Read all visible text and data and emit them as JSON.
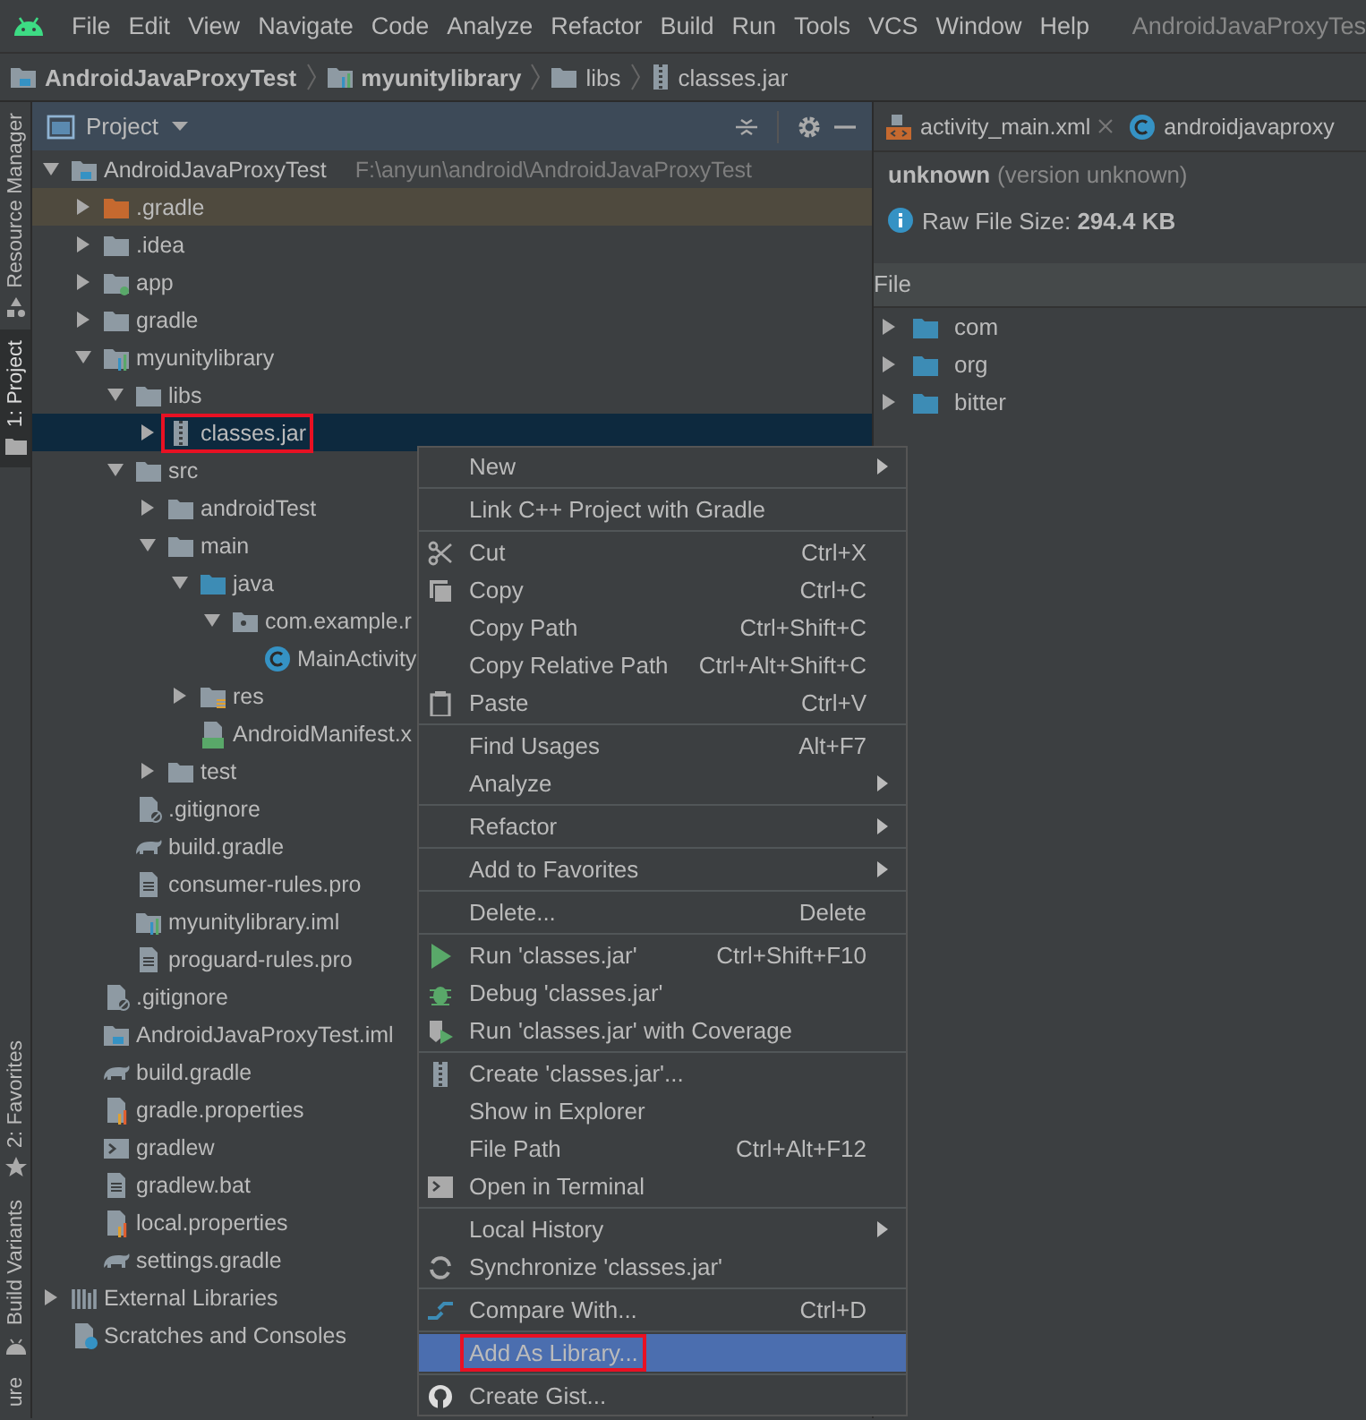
{
  "menu_bar": {
    "items": [
      "File",
      "Edit",
      "View",
      "Navigate",
      "Code",
      "Analyze",
      "Refactor",
      "Build",
      "Run",
      "Tools",
      "VCS",
      "Window",
      "Help"
    ],
    "title": "AndroidJavaProxyTes"
  },
  "breadcrumbs": [
    {
      "label": "AndroidJavaProxyTest",
      "kind": "project"
    },
    {
      "label": "myunitylibrary",
      "kind": "module"
    },
    {
      "label": "libs",
      "kind": "folder"
    },
    {
      "label": "classes.jar",
      "kind": "jar"
    }
  ],
  "tool_strip": {
    "top": [
      {
        "label": "Resource Manager",
        "kind": "resources",
        "selected": false
      },
      {
        "label": "1: Project",
        "kind": "project",
        "selected": true
      }
    ],
    "bottom": [
      {
        "label": "2: Favorites",
        "kind": "favorites",
        "selected": false
      },
      {
        "label": "Build Variants",
        "kind": "variants",
        "selected": false
      },
      {
        "label": "ure",
        "kind": "none",
        "selected": false
      }
    ]
  },
  "project_panel": {
    "title": "Project"
  },
  "tree": [
    {
      "label": "AndroidJavaProxyTest",
      "path": "F:\\anyun\\android\\AndroidJavaProxyTest",
      "kind": "project",
      "expanded": true,
      "selected": false,
      "highlighted": false,
      "children": [
        {
          "label": ".gradle",
          "kind": "excluded",
          "expanded": false,
          "selected": false,
          "highlighted": false
        },
        {
          "label": ".idea",
          "kind": "folder",
          "expanded": false,
          "selected": false,
          "highlighted": false
        },
        {
          "label": "app",
          "kind": "app-module",
          "expanded": false,
          "selected": false,
          "highlighted": false
        },
        {
          "label": "gradle",
          "kind": "folder",
          "expanded": false,
          "selected": false,
          "highlighted": false
        },
        {
          "label": "myunitylibrary",
          "kind": "module",
          "expanded": true,
          "selected": false,
          "highlighted": false,
          "children": [
            {
              "label": "libs",
              "kind": "folder",
              "expanded": true,
              "selected": false,
              "highlighted": false,
              "children": [
                {
                  "label": "classes.jar",
                  "kind": "jar",
                  "expanded": false,
                  "selected": true,
                  "highlighted": true
                }
              ]
            },
            {
              "label": "src",
              "kind": "folder",
              "expanded": true,
              "selected": false,
              "highlighted": false,
              "children": [
                {
                  "label": "androidTest",
                  "kind": "folder",
                  "expanded": false,
                  "selected": false,
                  "highlighted": false
                },
                {
                  "label": "main",
                  "kind": "folder",
                  "expanded": true,
                  "selected": false,
                  "highlighted": false,
                  "children": [
                    {
                      "label": "java",
                      "kind": "source-folder",
                      "expanded": true,
                      "selected": false,
                      "highlighted": false,
                      "children": [
                        {
                          "label": "com.example.r",
                          "kind": "package",
                          "expanded": true,
                          "selected": false,
                          "highlighted": false,
                          "children": [
                            {
                              "label": "MainActivity",
                              "kind": "class",
                              "selected": false,
                              "highlighted": false
                            }
                          ]
                        }
                      ]
                    },
                    {
                      "label": "res",
                      "kind": "res-folder",
                      "expanded": false,
                      "selected": false,
                      "highlighted": false
                    },
                    {
                      "label": "AndroidManifest.x",
                      "kind": "manifest",
                      "selected": false,
                      "highlighted": false
                    }
                  ]
                },
                {
                  "label": "test",
                  "kind": "folder",
                  "expanded": false,
                  "selected": false,
                  "highlighted": false
                }
              ]
            },
            {
              "label": ".gitignore",
              "kind": "ignore-file",
              "selected": false,
              "highlighted": false
            },
            {
              "label": "build.gradle",
              "kind": "gradle",
              "selected": false,
              "highlighted": false
            },
            {
              "label": "consumer-rules.pro",
              "kind": "doc",
              "selected": false,
              "highlighted": false
            },
            {
              "label": "myunitylibrary.iml",
              "kind": "module",
              "selected": false,
              "highlighted": false
            },
            {
              "label": "proguard-rules.pro",
              "kind": "doc",
              "selected": false,
              "highlighted": false
            }
          ]
        },
        {
          "label": ".gitignore",
          "kind": "ignore-file",
          "selected": false,
          "highlighted": false
        },
        {
          "label": "AndroidJavaProxyTest.iml",
          "kind": "project",
          "selected": false,
          "highlighted": false
        },
        {
          "label": "build.gradle",
          "kind": "gradle",
          "selected": false,
          "highlighted": false
        },
        {
          "label": "gradle.properties",
          "kind": "properties",
          "selected": false,
          "highlighted": false
        },
        {
          "label": "gradlew",
          "kind": "script",
          "selected": false,
          "highlighted": false
        },
        {
          "label": "gradlew.bat",
          "kind": "doc",
          "selected": false,
          "highlighted": false
        },
        {
          "label": "local.properties",
          "kind": "properties",
          "selected": false,
          "highlighted": false
        },
        {
          "label": "settings.gradle",
          "kind": "gradle",
          "selected": false,
          "highlighted": false
        }
      ]
    },
    {
      "label": "External Libraries",
      "kind": "libraries",
      "expanded": false,
      "selected": false,
      "highlighted": false
    },
    {
      "label": "Scratches and Consoles",
      "kind": "scratches",
      "selected": false,
      "highlighted": false
    }
  ],
  "editor": {
    "tabs": [
      {
        "label": "activity_main.xml",
        "kind": "xml",
        "closable": true
      },
      {
        "label": "androidjavaproxy",
        "kind": "class",
        "closable": false
      }
    ],
    "name": "unknown",
    "version": "(version unknown)",
    "size": "Raw File Size: **294.4 KB**",
    "column": "File",
    "tree": [
      {
        "label": "com",
        "expanded": false
      },
      {
        "label": "org",
        "expanded": false
      },
      {
        "label": "bitter",
        "expanded": false
      }
    ]
  },
  "context_menu": [
    [
      {
        "label": "New",
        "submenu": true,
        "selected": false,
        "highlighted": false
      }
    ],
    [
      {
        "label": "Link C++ Project with Gradle",
        "submenu": false,
        "selected": false,
        "highlighted": false
      }
    ],
    [
      {
        "label": "Cut",
        "shortcut": "Ctrl+X",
        "kind": "cut",
        "submenu": false,
        "selected": false,
        "highlighted": false
      },
      {
        "label": "Copy",
        "shortcut": "Ctrl+C",
        "kind": "copy",
        "submenu": false,
        "selected": false,
        "highlighted": false
      },
      {
        "label": "Copy Path",
        "shortcut": "Ctrl+Shift+C",
        "submenu": false,
        "selected": false,
        "highlighted": false
      },
      {
        "label": "Copy Relative Path",
        "shortcut": "Ctrl+Alt+Shift+C",
        "submenu": false,
        "selected": false,
        "highlighted": false
      },
      {
        "label": "Paste",
        "shortcut": "Ctrl+V",
        "kind": "paste",
        "submenu": false,
        "selected": false,
        "highlighted": false
      }
    ],
    [
      {
        "label": "Find Usages",
        "shortcut": "Alt+F7",
        "submenu": false,
        "selected": false,
        "highlighted": false
      },
      {
        "label": "Analyze",
        "submenu": true,
        "selected": false,
        "highlighted": false
      }
    ],
    [
      {
        "label": "Refactor",
        "submenu": true,
        "selected": false,
        "highlighted": false
      }
    ],
    [
      {
        "label": "Add to Favorites",
        "submenu": true,
        "selected": false,
        "highlighted": false
      }
    ],
    [
      {
        "label": "Delete...",
        "shortcut": "Delete",
        "submenu": false,
        "selected": false,
        "highlighted": false
      }
    ],
    [
      {
        "label": "Run 'classes.jar'",
        "shortcut": "Ctrl+Shift+F10",
        "kind": "run",
        "submenu": false,
        "selected": false,
        "highlighted": false
      },
      {
        "label": "Debug 'classes.jar'",
        "kind": "debug",
        "submenu": false,
        "selected": false,
        "highlighted": false
      },
      {
        "label": "Run 'classes.jar' with Coverage",
        "kind": "coverage",
        "submenu": false,
        "selected": false,
        "highlighted": false
      }
    ],
    [
      {
        "label": "Create 'classes.jar'...",
        "kind": "jar",
        "submenu": false,
        "selected": false,
        "highlighted": false
      },
      {
        "label": "Show in Explorer",
        "submenu": false,
        "selected": false,
        "highlighted": false
      },
      {
        "label": "File Path",
        "shortcut": "Ctrl+Alt+F12",
        "submenu": false,
        "selected": false,
        "highlighted": false
      },
      {
        "label": "Open in Terminal",
        "kind": "terminal",
        "submenu": false,
        "selected": false,
        "highlighted": false
      }
    ],
    [
      {
        "label": "Local History",
        "submenu": true,
        "selected": false,
        "highlighted": false
      },
      {
        "label": "Synchronize 'classes.jar'",
        "kind": "sync",
        "submenu": false,
        "selected": false,
        "highlighted": false
      }
    ],
    [
      {
        "label": "Compare With...",
        "shortcut": "Ctrl+D",
        "kind": "compare",
        "submenu": false,
        "selected": false,
        "highlighted": false
      }
    ],
    [
      {
        "label": "Add As Library...",
        "submenu": false,
        "selected": true,
        "highlighted": true
      }
    ],
    [
      {
        "label": "Create Gist...",
        "kind": "github",
        "submenu": false,
        "selected": false,
        "highlighted": false
      }
    ]
  ]
}
